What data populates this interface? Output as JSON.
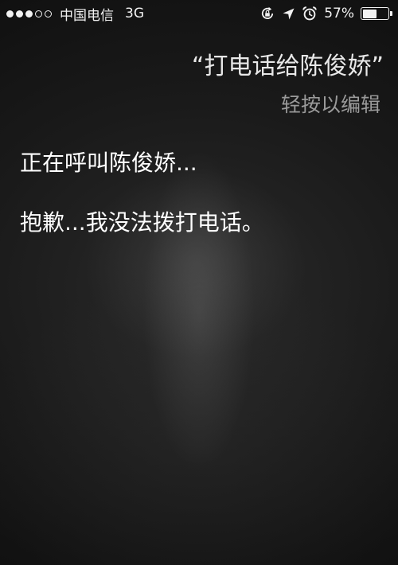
{
  "status_bar": {
    "carrier": "中国电信",
    "network": "3G",
    "signal_bars_total": 5,
    "signal_bars_filled": 3,
    "battery_percent_label": "57%",
    "battery_level": 0.57,
    "icons": [
      "rotation-lock-icon",
      "location-arrow-icon",
      "alarm-icon",
      "battery-icon"
    ]
  },
  "siri": {
    "query": "“打电话给陈俊娇”",
    "edit_hint": "轻按以编辑",
    "replies": [
      "正在呼叫陈俊娇...",
      "抱歉...我没法拨打电话。"
    ]
  },
  "colors": {
    "background": "#131313",
    "text_primary": "#ffffff",
    "text_secondary": "#9a9a9a"
  }
}
